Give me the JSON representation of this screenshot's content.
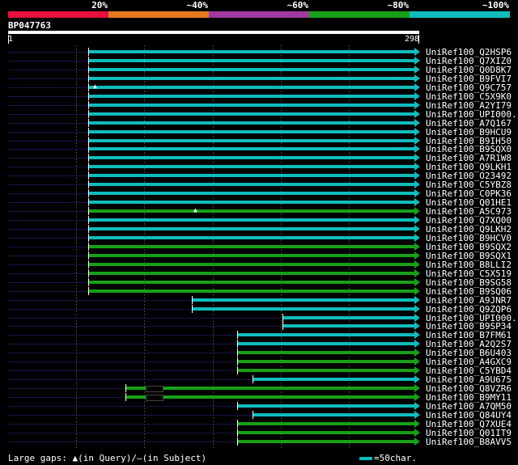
{
  "colors": {
    "background": "#000000",
    "seg_red": "#e8103c",
    "seg_orange": "#e87a1e",
    "seg_purple": "#a03aa0",
    "seg_green": "#18a018",
    "seg_cyan": "#10bcbc",
    "hit_cyan": "#10bcbc",
    "hit_green": "#18a018"
  },
  "legend": {
    "segments": [
      {
        "label": "20%",
        "color": "#e8103c"
      },
      {
        "label": "~40%",
        "color": "#e87a1e"
      },
      {
        "label": "~60%",
        "color": "#a03aa0"
      },
      {
        "label": "~80%",
        "color": "#18a018"
      },
      {
        "label": "~100%",
        "color": "#10bcbc"
      }
    ]
  },
  "query": {
    "id": "BP047763",
    "start": "1",
    "end": "298"
  },
  "hits": [
    {
      "name": "UniRef100_Q2HSP6",
      "start": 59,
      "color": "cyan"
    },
    {
      "name": "UniRef100_Q7XIZ0",
      "start": 59,
      "color": "cyan"
    },
    {
      "name": "UniRef100_Q0D8K7",
      "start": 59,
      "color": "cyan"
    },
    {
      "name": "UniRef100_B9FVI7",
      "start": 59,
      "color": "cyan"
    },
    {
      "name": "UniRef100_Q9C757",
      "start": 59,
      "color": "cyan",
      "gap_query": 64
    },
    {
      "name": "UniRef100_C5X9K0",
      "start": 59,
      "color": "cyan"
    },
    {
      "name": "UniRef100_A2YI79",
      "start": 59,
      "color": "cyan"
    },
    {
      "name": "UniRef100_UPI000..",
      "start": 59,
      "color": "cyan"
    },
    {
      "name": "UniRef100_A7Q167",
      "start": 59,
      "color": "cyan"
    },
    {
      "name": "UniRef100_B9HCU9",
      "start": 59,
      "color": "cyan"
    },
    {
      "name": "UniRef100_B9IH50",
      "start": 59,
      "color": "cyan"
    },
    {
      "name": "UniRef100_B9SQX0",
      "start": 59,
      "color": "cyan"
    },
    {
      "name": "UniRef100_A7R1W8",
      "start": 59,
      "color": "cyan"
    },
    {
      "name": "UniRef100_Q9LKH1",
      "start": 59,
      "color": "cyan"
    },
    {
      "name": "UniRef100_O23492",
      "start": 59,
      "color": "cyan"
    },
    {
      "name": "UniRef100_C5YBZ8",
      "start": 59,
      "color": "cyan"
    },
    {
      "name": "UniRef100_C0PK36",
      "start": 59,
      "color": "cyan"
    },
    {
      "name": "UniRef100_Q01HE1",
      "start": 59,
      "color": "cyan"
    },
    {
      "name": "UniRef100_A5C973",
      "start": 59,
      "color": "green",
      "gap_query": 138
    },
    {
      "name": "UniRef100_Q7XQ00",
      "start": 59,
      "color": "cyan"
    },
    {
      "name": "UniRef100_Q9LKH2",
      "start": 59,
      "color": "cyan"
    },
    {
      "name": "UniRef100_B9HCV0",
      "start": 59,
      "color": "cyan"
    },
    {
      "name": "UniRef100_B9SQX2",
      "start": 59,
      "color": "green"
    },
    {
      "name": "UniRef100_B9SQX1",
      "start": 59,
      "color": "green"
    },
    {
      "name": "UniRef100_B8LLI2",
      "start": 59,
      "color": "green"
    },
    {
      "name": "UniRef100_C5X519",
      "start": 59,
      "color": "green"
    },
    {
      "name": "UniRef100_B9SG58",
      "start": 59,
      "color": "green"
    },
    {
      "name": "UniRef100_B9SQ06",
      "start": 59,
      "color": "green"
    },
    {
      "name": "UniRef100_A9JNR7",
      "start": 135,
      "color": "cyan"
    },
    {
      "name": "UniRef100_Q9ZQP6",
      "start": 135,
      "color": "cyan"
    },
    {
      "name": "UniRef100_UPI000..",
      "start": 201,
      "color": "cyan"
    },
    {
      "name": "UniRef100_B9SP34",
      "start": 201,
      "color": "cyan"
    },
    {
      "name": "UniRef100_B7FM61",
      "start": 168,
      "color": "cyan"
    },
    {
      "name": "UniRef100_A2Q2S7",
      "start": 168,
      "color": "cyan"
    },
    {
      "name": "UniRef100_B6U403",
      "start": 168,
      "color": "green"
    },
    {
      "name": "UniRef100_A4GXC9",
      "start": 168,
      "color": "green"
    },
    {
      "name": "UniRef100_C5YBD4",
      "start": 168,
      "color": "green"
    },
    {
      "name": "UniRef100_A9U675",
      "start": 179,
      "color": "cyan"
    },
    {
      "name": "UniRef100_Q8VZR6",
      "start": 86,
      "color": "green",
      "gap_box": [
        101,
        113
      ]
    },
    {
      "name": "UniRef100_B9MY11",
      "start": 86,
      "color": "green",
      "gap_box": [
        101,
        113
      ]
    },
    {
      "name": "UniRef100_A7QM50",
      "start": 168,
      "color": "cyan"
    },
    {
      "name": "UniRef100_Q84UY4",
      "start": 179,
      "color": "cyan"
    },
    {
      "name": "UniRef100_Q7XUE4",
      "start": 168,
      "color": "green"
    },
    {
      "name": "UniRef100_Q01IT9",
      "start": 168,
      "color": "green"
    },
    {
      "name": "UniRef100_B8AVV5",
      "start": 168,
      "color": "green"
    }
  ],
  "footer": {
    "gaps_prefix": "Large gaps:",
    "query_marker": "▲",
    "query_text": "(in Query)/",
    "subject_marker": "—",
    "subject_text": "(in Subject)",
    "scale_text": "=50char."
  }
}
